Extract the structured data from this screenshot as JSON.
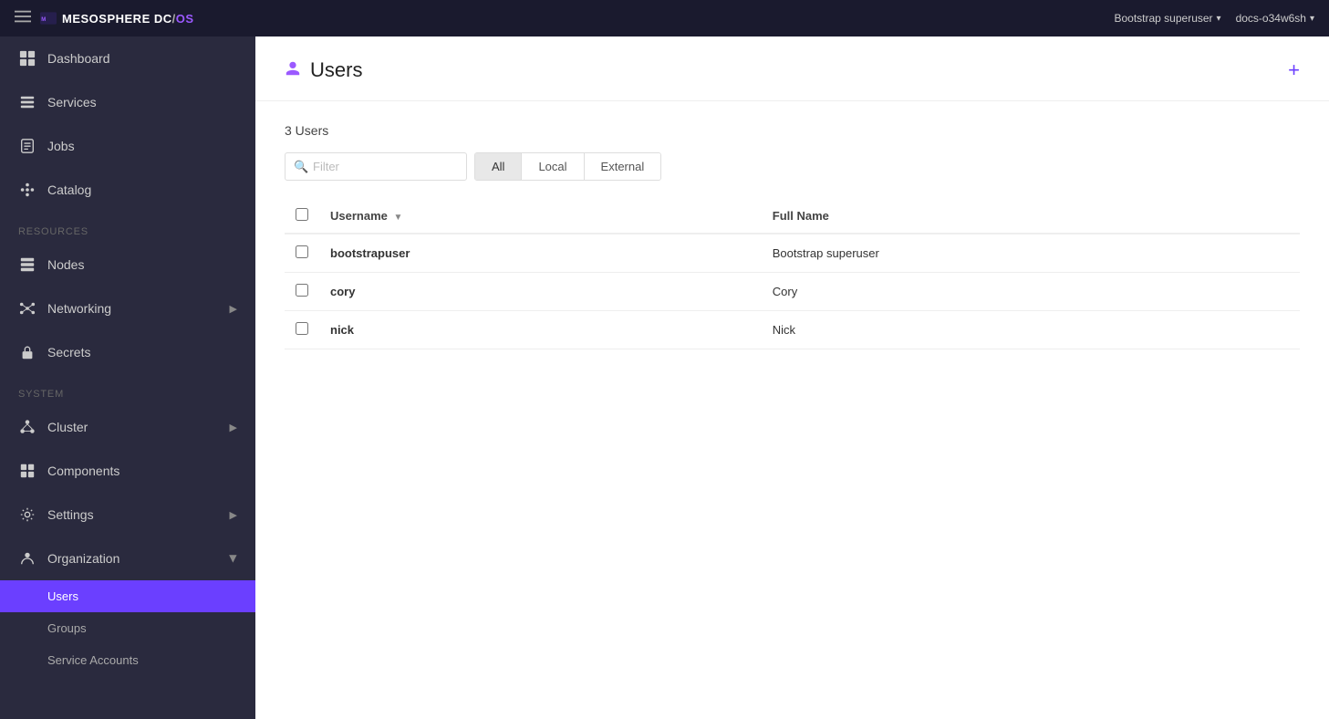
{
  "topbar": {
    "hamburger_icon": "☰",
    "logo_text_main": "MESOSPHERE",
    "logo_dc": "DC",
    "logo_slash": "/",
    "logo_os": "OS",
    "user_label": "Bootstrap superuser",
    "cluster_label": "docs-o34w6sh",
    "caret": "▾"
  },
  "sidebar": {
    "nav_items": [
      {
        "id": "dashboard",
        "label": "Dashboard",
        "icon": "dashboard"
      },
      {
        "id": "services",
        "label": "Services",
        "icon": "services"
      },
      {
        "id": "jobs",
        "label": "Jobs",
        "icon": "jobs"
      },
      {
        "id": "catalog",
        "label": "Catalog",
        "icon": "catalog"
      }
    ],
    "resources_label": "Resources",
    "resources_items": [
      {
        "id": "nodes",
        "label": "Nodes",
        "icon": "nodes"
      },
      {
        "id": "networking",
        "label": "Networking",
        "icon": "networking",
        "arrow": true
      },
      {
        "id": "secrets",
        "label": "Secrets",
        "icon": "secrets"
      }
    ],
    "system_label": "System",
    "system_items": [
      {
        "id": "cluster",
        "label": "Cluster",
        "icon": "cluster",
        "arrow": true
      },
      {
        "id": "components",
        "label": "Components",
        "icon": "components"
      },
      {
        "id": "settings",
        "label": "Settings",
        "icon": "settings",
        "arrow": true
      },
      {
        "id": "organization",
        "label": "Organization",
        "icon": "organization",
        "arrow_down": true
      }
    ],
    "org_sub_items": [
      {
        "id": "users",
        "label": "Users",
        "active": true
      },
      {
        "id": "groups",
        "label": "Groups"
      },
      {
        "id": "service-accounts",
        "label": "Service Accounts"
      }
    ]
  },
  "page": {
    "title": "Users",
    "add_btn": "+",
    "users_count": "3 Users",
    "filter_placeholder": "Filter",
    "tabs": [
      {
        "id": "all",
        "label": "All",
        "active": true
      },
      {
        "id": "local",
        "label": "Local"
      },
      {
        "id": "external",
        "label": "External"
      }
    ],
    "table": {
      "col_username": "Username",
      "col_fullname": "Full Name",
      "rows": [
        {
          "username": "bootstrapuser",
          "fullname": "Bootstrap superuser",
          "fullname_class": "fullname-bootstrap"
        },
        {
          "username": "cory",
          "fullname": "Cory",
          "fullname_class": "fullname-cory"
        },
        {
          "username": "nick",
          "fullname": "Nick",
          "fullname_class": "fullname-nick"
        }
      ]
    }
  }
}
